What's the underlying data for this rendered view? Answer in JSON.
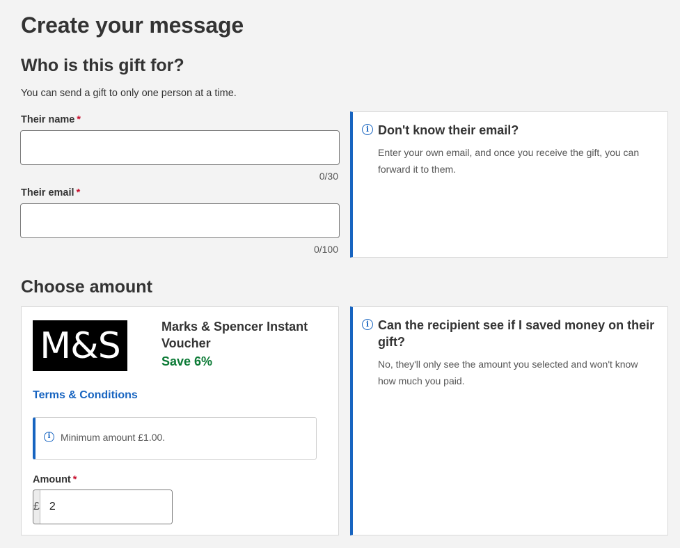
{
  "page_title": "Create your message",
  "recipient": {
    "heading": "Who is this gift for?",
    "subtext": "You can send a gift to only one person at a time.",
    "name_label": "Their name",
    "name_value": "",
    "name_counter": "0/30",
    "email_label": "Their email",
    "email_value": "",
    "email_counter": "0/100",
    "required_marker": "*"
  },
  "email_help": {
    "icon": "info-icon",
    "title": "Don't know their email?",
    "body": "Enter your own email, and once you receive the gift, you can forward it to them."
  },
  "amount_section": {
    "heading": "Choose amount",
    "logo_text": "M&S",
    "product_name": "Marks & Spencer Instant Voucher",
    "save_text": "Save 6%",
    "terms_link": "Terms & Conditions",
    "minimum_notice": "Minimum amount £1.00.",
    "amount_label": "Amount",
    "currency_symbol": "£",
    "amount_value": "2"
  },
  "savings_help": {
    "icon": "info-icon",
    "title": "Can the recipient see if I saved money on their gift?",
    "body": "No, they'll only see the amount you selected and won't know how much you paid."
  },
  "colors": {
    "accent_blue": "#1764c0",
    "save_green": "#0b7a35",
    "required_red": "#c8102e",
    "background": "#f3f3f3"
  }
}
